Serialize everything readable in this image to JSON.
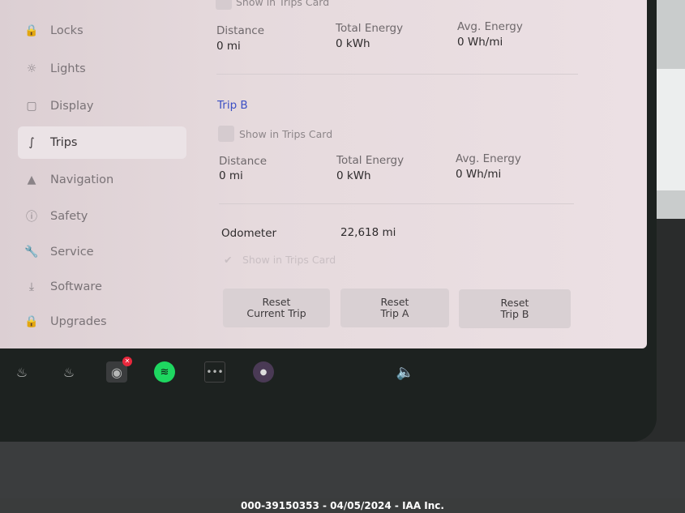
{
  "sidebar": {
    "items": [
      {
        "label": "Locks",
        "icon": "lock-icon"
      },
      {
        "label": "Lights",
        "icon": "sun-icon"
      },
      {
        "label": "Display",
        "icon": "display-icon"
      },
      {
        "label": "Trips",
        "icon": "trips-icon",
        "active": true
      },
      {
        "label": "Navigation",
        "icon": "navigation-arrow-icon"
      },
      {
        "label": "Safety",
        "icon": "alert-circle-icon"
      },
      {
        "label": "Service",
        "icon": "wrench-icon"
      },
      {
        "label": "Software",
        "icon": "download-icon"
      },
      {
        "label": "Upgrades",
        "icon": "bag-icon"
      }
    ]
  },
  "trip_a": {
    "show_label": "Show in Trips Card",
    "distance_label": "Distance",
    "distance": "0 mi",
    "energy_label": "Total Energy",
    "energy": "0 kWh",
    "avg_label": "Avg. Energy",
    "avg": "0 Wh/mi"
  },
  "trip_b": {
    "title": "Trip B",
    "show_label": "Show in Trips Card",
    "distance_label": "Distance",
    "distance": "0 mi",
    "energy_label": "Total Energy",
    "energy": "0 kWh",
    "avg_label": "Avg. Energy",
    "avg": "0 Wh/mi"
  },
  "odometer": {
    "label": "Odometer",
    "value": "22,618 mi",
    "show_label": "Show in Trips Card"
  },
  "buttons": {
    "reset_current": "Reset\nCurrent Trip",
    "reset_a": "Reset\nTrip A",
    "reset_b": "Reset\nTrip B"
  },
  "colors": {
    "accent": "#3b4fc4",
    "spotify": "#1ed760",
    "badge": "#e8283c"
  },
  "watermark": "000-39150353 - 04/05/2024 - IAA Inc."
}
